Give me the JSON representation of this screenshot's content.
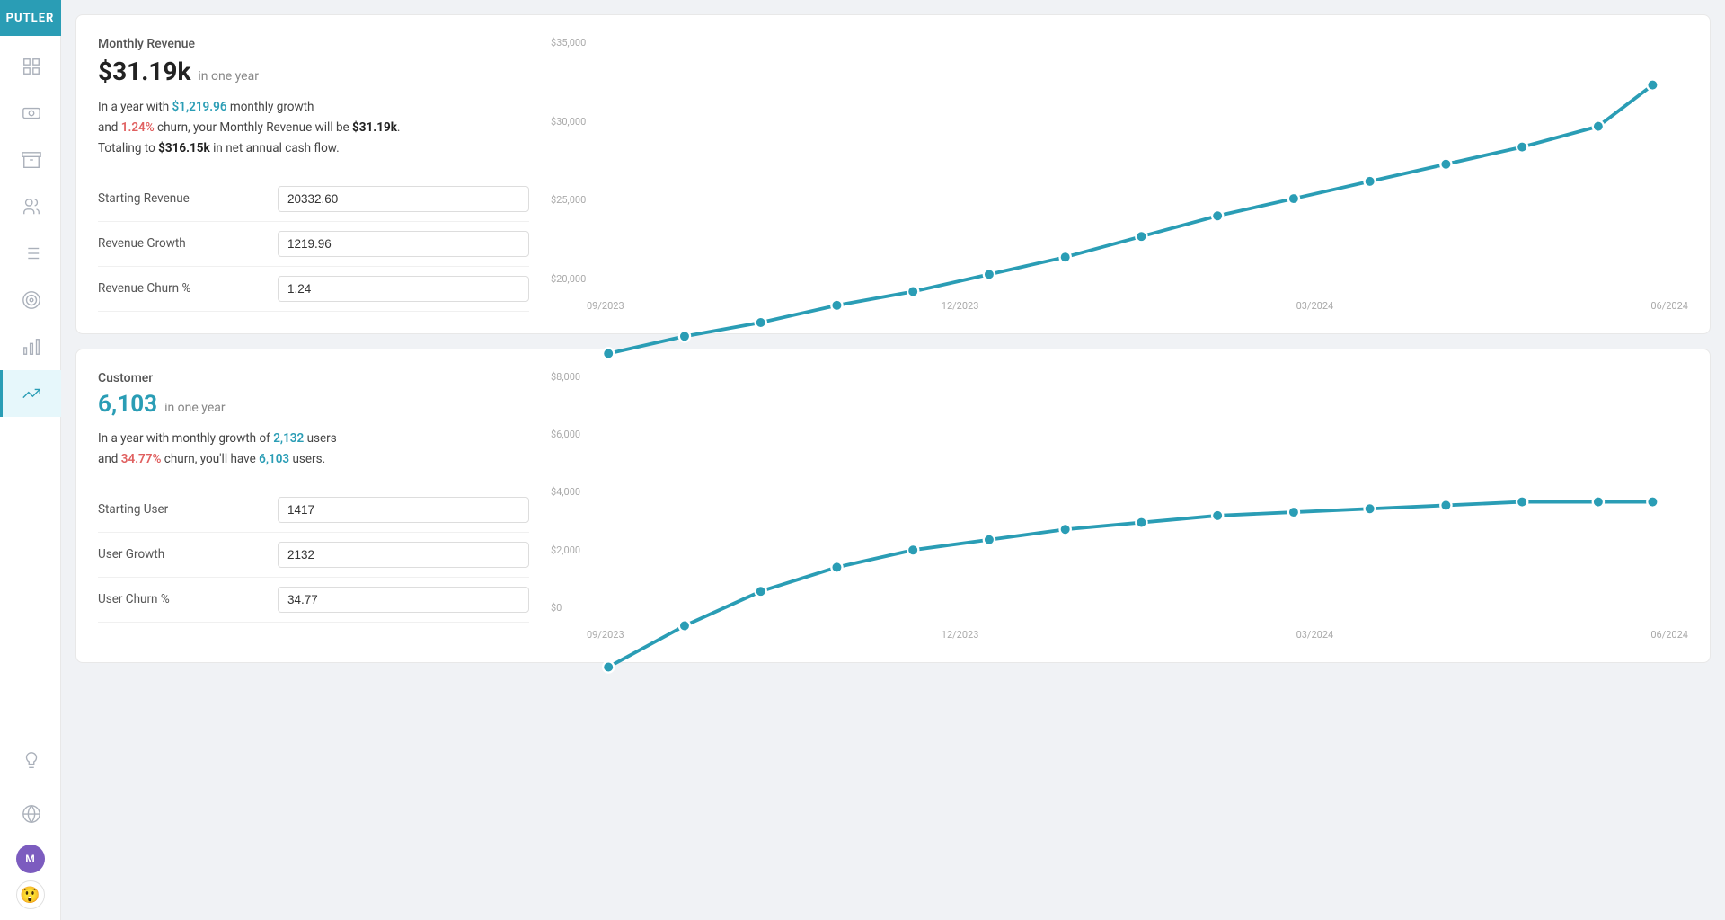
{
  "app": {
    "name": "PUTLER"
  },
  "sidebar": {
    "items": [
      {
        "id": "dashboard",
        "icon": "grid",
        "active": false
      },
      {
        "id": "revenue",
        "icon": "dollar",
        "active": false
      },
      {
        "id": "archive",
        "icon": "archive",
        "active": false
      },
      {
        "id": "customers",
        "icon": "users",
        "active": false
      },
      {
        "id": "reports",
        "icon": "list",
        "active": false
      },
      {
        "id": "goals",
        "icon": "target",
        "active": false
      },
      {
        "id": "analytics",
        "icon": "bar-chart",
        "active": false
      },
      {
        "id": "forecast",
        "icon": "trend",
        "active": true
      }
    ],
    "bottom": [
      {
        "id": "bulb",
        "icon": "bulb"
      },
      {
        "id": "globe",
        "icon": "globe"
      }
    ],
    "avatars": [
      {
        "id": "user-m",
        "label": "M",
        "color": "#7c5cbf"
      },
      {
        "id": "emoji",
        "label": "😲"
      }
    ]
  },
  "revenue_card": {
    "title": "Monthly Revenue",
    "big_value": "$31.19k",
    "in_year_label": "in one year",
    "desc_prefix": "In a year with ",
    "growth_highlight": "$1,219.96",
    "desc_middle": " monthly growth\nand ",
    "churn_highlight": "1.24%",
    "desc_suffix": " churn, your Monthly Revenue will be ",
    "end_value": "$31.19k",
    "desc_end": ".\nTotaling to ",
    "total_value": "$316.15k",
    "desc_final": " in net annual cash flow.",
    "fields": [
      {
        "label": "Starting Revenue",
        "value": "20332.60",
        "id": "starting-revenue"
      },
      {
        "label": "Revenue Growth",
        "value": "1219.96",
        "id": "revenue-growth"
      },
      {
        "label": "Revenue Churn %",
        "value": "1.24",
        "id": "revenue-churn"
      }
    ],
    "chart": {
      "y_labels": [
        "$35,000",
        "$30,000",
        "$25,000",
        "$20,000"
      ],
      "x_labels": [
        "09/2023",
        "12/2023",
        "03/2024",
        "06/2024"
      ],
      "color": "#2a9db5",
      "points": [
        {
          "x": 0.02,
          "y": 0.88
        },
        {
          "x": 0.09,
          "y": 0.83
        },
        {
          "x": 0.16,
          "y": 0.79
        },
        {
          "x": 0.23,
          "y": 0.74
        },
        {
          "x": 0.3,
          "y": 0.7
        },
        {
          "x": 0.37,
          "y": 0.65
        },
        {
          "x": 0.44,
          "y": 0.6
        },
        {
          "x": 0.51,
          "y": 0.54
        },
        {
          "x": 0.58,
          "y": 0.48
        },
        {
          "x": 0.65,
          "y": 0.43
        },
        {
          "x": 0.72,
          "y": 0.38
        },
        {
          "x": 0.79,
          "y": 0.33
        },
        {
          "x": 0.86,
          "y": 0.28
        },
        {
          "x": 0.93,
          "y": 0.22
        },
        {
          "x": 0.98,
          "y": 0.1
        }
      ]
    }
  },
  "customer_card": {
    "title": "Customer",
    "big_value": "6,103",
    "in_year_label": "in one year",
    "desc_prefix": "In a year with monthly growth of ",
    "growth_highlight": "2,132",
    "growth_suffix": " users",
    "desc_middle": "\nand ",
    "churn_highlight": "34.77%",
    "desc_suffix": " churn, you'll have ",
    "end_value": "6,103",
    "desc_end": " users.",
    "fields": [
      {
        "label": "Starting User",
        "value": "1417",
        "id": "starting-user"
      },
      {
        "label": "User Growth",
        "value": "2132",
        "id": "user-growth"
      },
      {
        "label": "User Churn %",
        "value": "34.77",
        "id": "user-churn"
      }
    ],
    "chart": {
      "y_labels": [
        "$8,000",
        "$6,000",
        "$4,000",
        "$2,000",
        "$0"
      ],
      "x_labels": [
        "09/2023",
        "12/2023",
        "03/2024",
        "06/2024"
      ],
      "color": "#2a9db5",
      "points": [
        {
          "x": 0.02,
          "y": 0.82
        },
        {
          "x": 0.09,
          "y": 0.7
        },
        {
          "x": 0.16,
          "y": 0.6
        },
        {
          "x": 0.23,
          "y": 0.53
        },
        {
          "x": 0.3,
          "y": 0.48
        },
        {
          "x": 0.37,
          "y": 0.45
        },
        {
          "x": 0.44,
          "y": 0.42
        },
        {
          "x": 0.51,
          "y": 0.4
        },
        {
          "x": 0.58,
          "y": 0.38
        },
        {
          "x": 0.65,
          "y": 0.37
        },
        {
          "x": 0.72,
          "y": 0.36
        },
        {
          "x": 0.79,
          "y": 0.35
        },
        {
          "x": 0.86,
          "y": 0.34
        },
        {
          "x": 0.93,
          "y": 0.34
        },
        {
          "x": 0.98,
          "y": 0.34
        }
      ]
    }
  }
}
